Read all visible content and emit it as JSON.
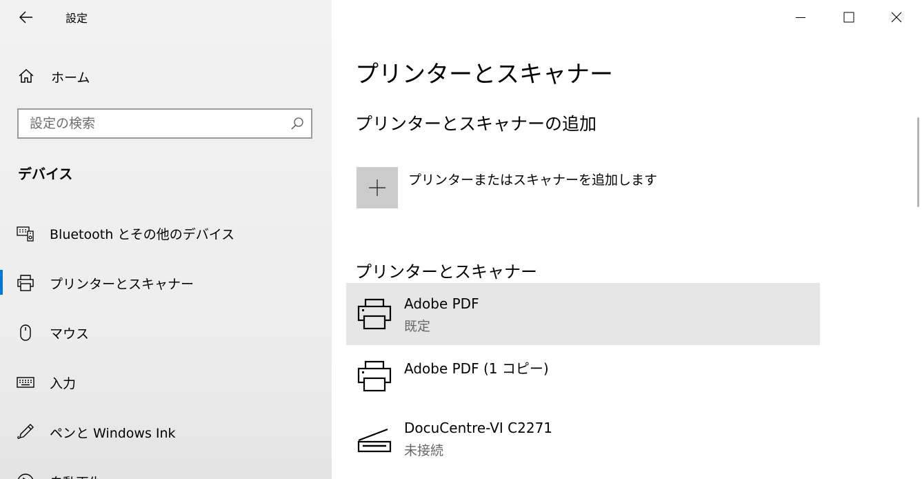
{
  "window": {
    "title": "設定",
    "controls": [
      "minimize",
      "maximize",
      "close"
    ]
  },
  "sidebar": {
    "home_label": "ホーム",
    "search": {
      "placeholder": "設定の検索",
      "value": ""
    },
    "section": "デバイス",
    "items": [
      {
        "label": "Bluetooth とその他のデバイス",
        "icon": "bluetooth-devices-icon",
        "selected": false
      },
      {
        "label": "プリンターとスキャナー",
        "icon": "printer-icon",
        "selected": true
      },
      {
        "label": "マウス",
        "icon": "mouse-icon",
        "selected": false
      },
      {
        "label": "入力",
        "icon": "keyboard-icon",
        "selected": false
      },
      {
        "label": "ペンと Windows Ink",
        "icon": "pen-icon",
        "selected": false
      },
      {
        "label": "自動再生",
        "icon": "autoplay-icon",
        "selected": false
      }
    ]
  },
  "main": {
    "page_title": "プリンターとスキャナー",
    "add_section_title": "プリンターとスキャナーの追加",
    "add_button_label": "プリンターまたはスキャナーを追加します",
    "list_title": "プリンターとスキャナー",
    "devices": [
      {
        "name": "Adobe PDF",
        "status": "既定",
        "icon": "printer-icon",
        "selected": true
      },
      {
        "name": "Adobe PDF (1 コピー)",
        "status": "",
        "icon": "printer-icon",
        "selected": false
      },
      {
        "name": "DocuCentre-VI C2271",
        "status": "未接続",
        "icon": "scanner-icon",
        "selected": false
      }
    ]
  },
  "colors": {
    "accent": "#0078d7",
    "selected_row": "#e6e6e6",
    "sidebar_bg": "#f2f2f2"
  }
}
